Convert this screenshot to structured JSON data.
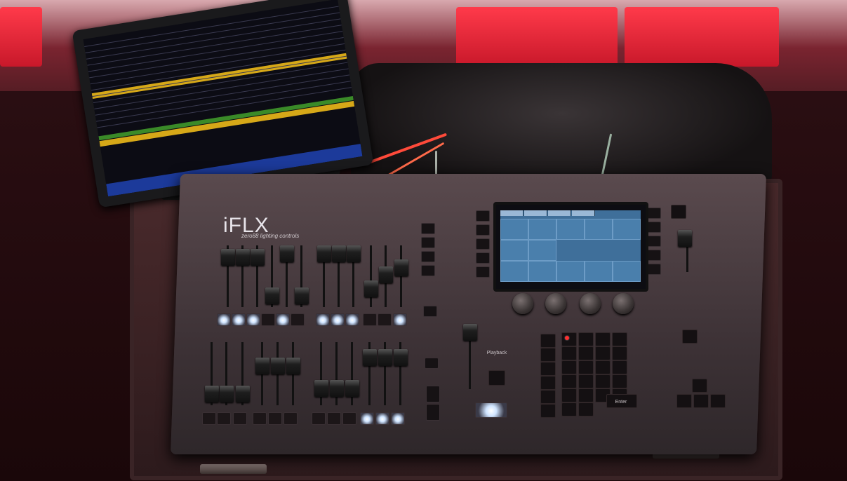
{
  "console": {
    "brand": "iFLX",
    "subtitle": "zero88 lighting controls",
    "playback_label": "Playback",
    "enter_key": "Enter"
  },
  "colors": {
    "ambient_red": "#c8182a",
    "lit_button": "#cfe4ff",
    "touch_screen": "#3f6f9a",
    "tablet_bar_yellow": "#d6a818",
    "tablet_bar_blue": "#1c3a9a"
  }
}
